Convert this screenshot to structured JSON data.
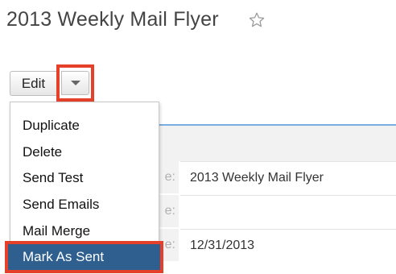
{
  "header": {
    "title": "2013 Weekly Mail Flyer",
    "favorite_icon": "star-outline-icon"
  },
  "actions": {
    "edit_label": "Edit",
    "dropdown_icon": "chevron-down-icon"
  },
  "menu": {
    "items": [
      {
        "label": "Duplicate"
      },
      {
        "label": "Delete"
      },
      {
        "label": "Send Test"
      },
      {
        "label": "Send Emails"
      },
      {
        "label": "Mail Merge"
      },
      {
        "label": "Mark As Sent",
        "highlighted": true
      }
    ]
  },
  "details": {
    "rows": [
      {
        "label_fragment": "e:",
        "value": "2013 Weekly Mail Flyer"
      },
      {
        "label_fragment": "e:",
        "value": ""
      },
      {
        "label_fragment": "e:",
        "value": "12/31/2013"
      }
    ]
  },
  "colors": {
    "highlight_border": "#e5412a",
    "selected_item_bg": "#2f5f8f",
    "panel_rule": "#79aee0"
  }
}
